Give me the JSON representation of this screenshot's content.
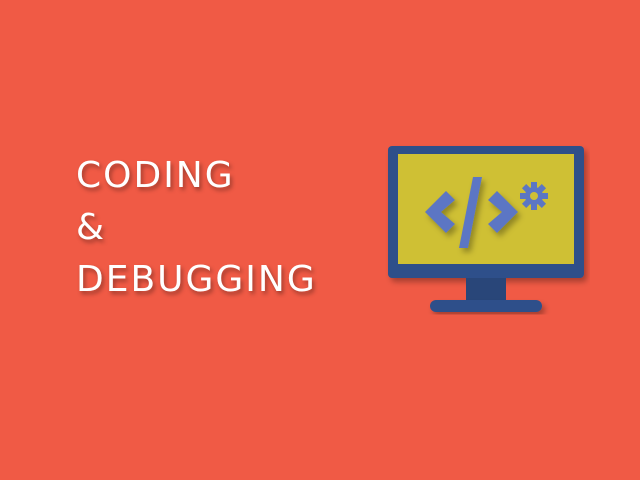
{
  "title": {
    "line1": "CODING",
    "line2": "&",
    "line3": "DEBUGGING"
  },
  "illustration": {
    "monitor_icon": "monitor-icon",
    "code_icon": "code-tag-icon",
    "gear_icon": "gear-icon",
    "code_glyph": "</>"
  },
  "colors": {
    "background": "#f05a45",
    "text": "#ffffff",
    "monitor_frame": "#2f4f8a",
    "screen": "#cfc034",
    "code": "#5b76c4"
  }
}
